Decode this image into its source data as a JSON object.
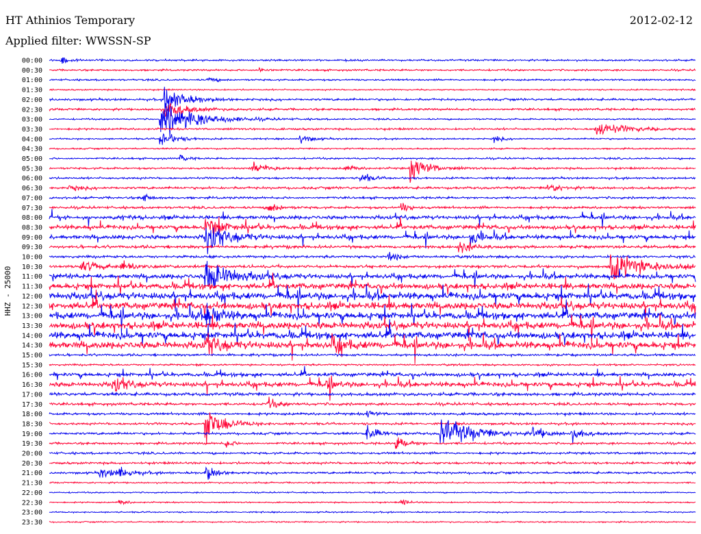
{
  "header": {
    "station": "HT Athinios Temporary",
    "filter": "Applied filter: WWSSN-SP",
    "date": "2012-02-12"
  },
  "chart_data": {
    "type": "line",
    "title": "HT Athinios Temporary",
    "ylabel": "HHZ - 25000",
    "rows": [
      "00:00",
      "00:30",
      "01:00",
      "01:30",
      "02:00",
      "02:30",
      "03:00",
      "03:30",
      "04:00",
      "04:30",
      "05:00",
      "05:30",
      "06:00",
      "06:30",
      "07:00",
      "07:30",
      "08:00",
      "08:30",
      "09:00",
      "09:30",
      "10:00",
      "10:30",
      "11:00",
      "11:30",
      "12:00",
      "12:30",
      "13:00",
      "13:30",
      "14:00",
      "14:30",
      "15:00",
      "15:30",
      "16:00",
      "16:30",
      "17:00",
      "17:30",
      "18:00",
      "18:30",
      "19:00",
      "19:30",
      "20:00",
      "20:30",
      "21:00",
      "21:30",
      "22:00",
      "22:30",
      "23:00",
      "23:30"
    ],
    "time_range_minutes": [
      0,
      30
    ],
    "colors": {
      "even": "#0000ee",
      "odd": "#ff0033"
    },
    "noise": [
      0.8,
      0.8,
      0.8,
      0.6,
      1,
      1,
      0.7,
      0.9,
      0.7,
      0.7,
      0.8,
      0.9,
      0.9,
      1.1,
      1,
      1.1,
      1.6,
      1.8,
      1.8,
      1.3,
      1.1,
      1.3,
      2,
      2.5,
      3,
      3,
      3,
      3,
      3,
      3,
      1,
      0.8,
      1.6,
      2,
      1.4,
      1.2,
      1.1,
      1,
      1.1,
      1,
      1,
      1,
      1,
      0.7,
      0.6,
      0.6,
      0.6,
      0.6
    ],
    "events": [
      {
        "row": 0,
        "t": 0.6,
        "amp": 3,
        "decay": 0.3
      },
      {
        "row": 1,
        "t": 9.8,
        "amp": 3,
        "decay": 0.3
      },
      {
        "row": 2,
        "t": 7.4,
        "amp": 3,
        "decay": 0.3
      },
      {
        "row": 4,
        "t": 5.4,
        "amp": 14,
        "decay": 0.8
      },
      {
        "row": 5,
        "t": 5.4,
        "amp": 10,
        "decay": 0.8
      },
      {
        "row": 6,
        "t": 5.2,
        "amp": 18,
        "decay": 1.5
      },
      {
        "row": 7,
        "t": 25.4,
        "amp": 7,
        "decay": 1.2
      },
      {
        "row": 8,
        "t": 5.2,
        "amp": 8,
        "decay": 0.6
      },
      {
        "row": 8,
        "t": 11.7,
        "amp": 5,
        "decay": 0.4
      },
      {
        "row": 8,
        "t": 20.7,
        "amp": 3,
        "decay": 0.3
      },
      {
        "row": 10,
        "t": 6.1,
        "amp": 3,
        "decay": 0.3
      },
      {
        "row": 11,
        "t": 9.5,
        "amp": 5,
        "decay": 0.8
      },
      {
        "row": 11,
        "t": 13.8,
        "amp": 3,
        "decay": 0.4
      },
      {
        "row": 11,
        "t": 16.8,
        "amp": 13,
        "decay": 0.7
      },
      {
        "row": 12,
        "t": 14.5,
        "amp": 5,
        "decay": 0.4
      },
      {
        "row": 13,
        "t": 1,
        "amp": 3,
        "decay": 0.4
      },
      {
        "row": 13,
        "t": 23.2,
        "amp": 5,
        "decay": 0.5
      },
      {
        "row": 14,
        "t": 4.3,
        "amp": 5,
        "decay": 0.3
      },
      {
        "row": 15,
        "t": 10.2,
        "amp": 6,
        "decay": 0.4
      },
      {
        "row": 15,
        "t": 16.4,
        "amp": 5,
        "decay": 0.3
      },
      {
        "row": 17,
        "t": 7.3,
        "amp": 10,
        "decay": 0.8
      },
      {
        "row": 18,
        "t": 7.3,
        "amp": 14,
        "decay": 0.9
      },
      {
        "row": 18,
        "t": 19.6,
        "amp": 8,
        "decay": 0.4
      },
      {
        "row": 19,
        "t": 19,
        "amp": 6,
        "decay": 0.6
      },
      {
        "row": 20,
        "t": 15.8,
        "amp": 5,
        "decay": 0.4
      },
      {
        "row": 21,
        "t": 1.5,
        "amp": 5,
        "decay": 0.7
      },
      {
        "row": 21,
        "t": 3.4,
        "amp": 5,
        "decay": 0.7
      },
      {
        "row": 21,
        "t": 26.1,
        "amp": 14,
        "decay": 1.5
      },
      {
        "row": 22,
        "t": 7.3,
        "amp": 18,
        "decay": 1
      },
      {
        "row": 26,
        "t": 7.3,
        "amp": 12,
        "decay": 0.6
      },
      {
        "row": 29,
        "t": 7.3,
        "amp": 10,
        "decay": 0.6
      },
      {
        "row": 29,
        "t": 13.2,
        "amp": 8,
        "decay": 0.5
      },
      {
        "row": 33,
        "t": 3,
        "amp": 7,
        "decay": 0.6
      },
      {
        "row": 33,
        "t": 12.9,
        "amp": 5,
        "decay": 0.4
      },
      {
        "row": 35,
        "t": 10.2,
        "amp": 5,
        "decay": 0.4
      },
      {
        "row": 36,
        "t": 14.8,
        "amp": 4,
        "decay": 0.3
      },
      {
        "row": 37,
        "t": 7.3,
        "amp": 16,
        "decay": 0.8
      },
      {
        "row": 38,
        "t": 14.8,
        "amp": 7,
        "decay": 0.5
      },
      {
        "row": 38,
        "t": 18.2,
        "amp": 16,
        "decay": 1.3
      },
      {
        "row": 38,
        "t": 22.5,
        "amp": 6,
        "decay": 0.5
      },
      {
        "row": 38,
        "t": 24.3,
        "amp": 6,
        "decay": 0.5
      },
      {
        "row": 39,
        "t": 16.1,
        "amp": 7,
        "decay": 0.5
      },
      {
        "row": 39,
        "t": 8.2,
        "amp": 4,
        "decay": 0.3
      },
      {
        "row": 42,
        "t": 2.4,
        "amp": 5,
        "decay": 0.7
      },
      {
        "row": 42,
        "t": 3.3,
        "amp": 4,
        "decay": 0.5
      },
      {
        "row": 42,
        "t": 7.3,
        "amp": 8,
        "decay": 0.4
      },
      {
        "row": 45,
        "t": 3.3,
        "amp": 3,
        "decay": 0.3
      },
      {
        "row": 45,
        "t": 16.4,
        "amp": 3,
        "decay": 0.3
      }
    ]
  }
}
